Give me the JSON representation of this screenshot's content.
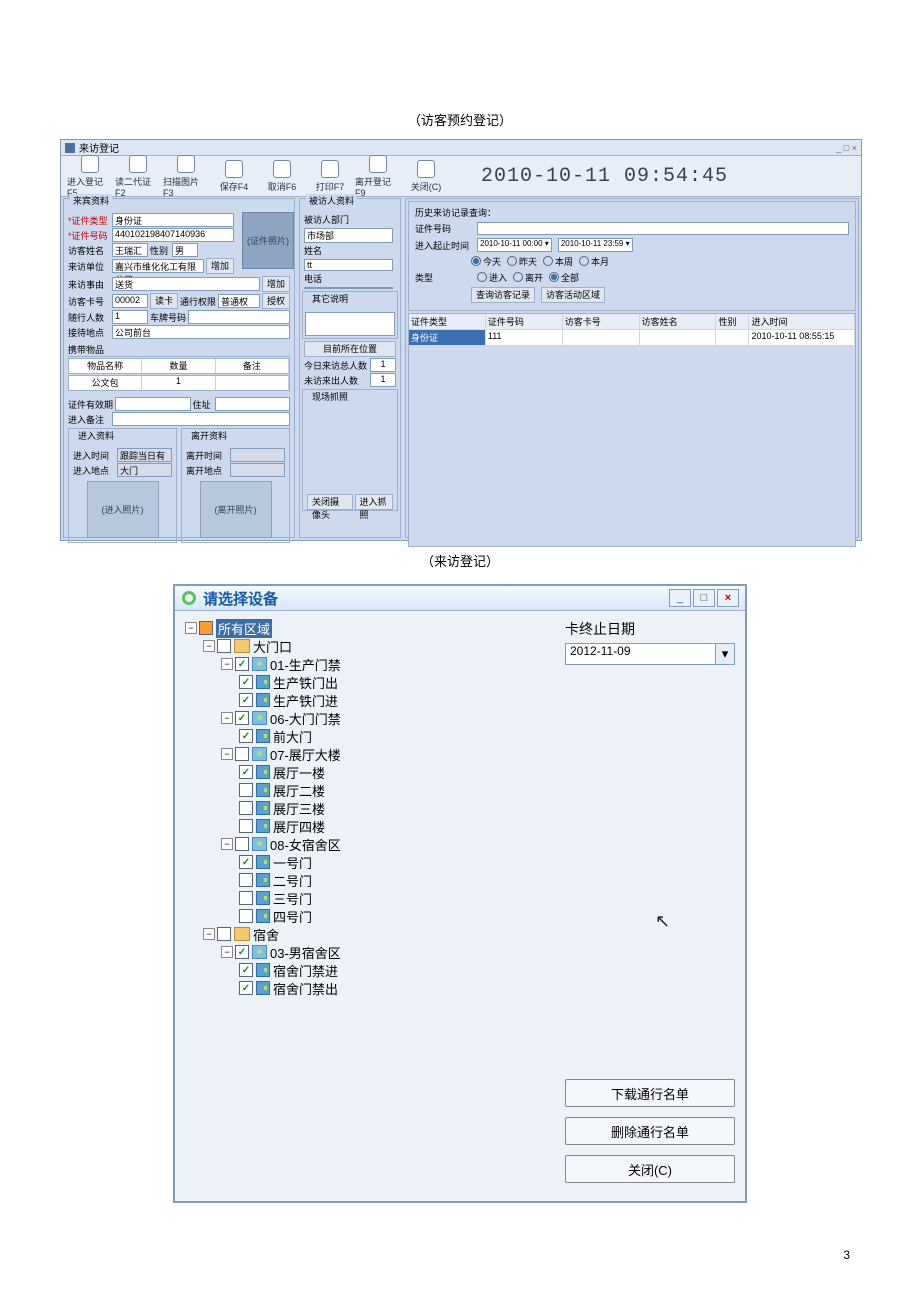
{
  "captions": {
    "appointment": "（访客预约登记）",
    "visit": "（来访登记）"
  },
  "page_number": "3",
  "app1": {
    "window_title": "来访登记",
    "window_controls": "_  □  ×",
    "toolbar": [
      {
        "label": "进入登记F5"
      },
      {
        "label": "读二代证F2"
      },
      {
        "label": "扫描图片F3"
      },
      {
        "label": "保存F4"
      },
      {
        "label": "取消F6"
      },
      {
        "label": "打印F7"
      },
      {
        "label": "离开登记F9"
      },
      {
        "label": "关闭(C)"
      }
    ],
    "clock": "2010-10-11 09:54:45",
    "guest_group": "来宾资料",
    "id_type_lbl": "*证件类型",
    "id_type_val": "身份证",
    "id_num_lbl": "*证件号码",
    "id_num_val": "440102198407140936",
    "name_lbl": "访客姓名",
    "name_val": "王瑞汇",
    "sex_lbl": "性别",
    "sex_val": "男",
    "unit_lbl": "来访单位",
    "unit_val": "嘉兴市维化化工有限公司",
    "unit_btn": "增加",
    "cert_photo": "(证件照片)",
    "reason_lbl": "来访事由",
    "reason_val": "送货",
    "reason_btn": "增加",
    "card_lbl": "访客卡号",
    "card_val": "00002",
    "card_btn": "读卡",
    "perm_lbl": "通行权限",
    "perm_val": "普通权限",
    "perm_btn": "授权",
    "follow_cnt_lbl": "随行人数",
    "follow_cnt_val": "1",
    "plate_lbl": "车牌号码",
    "recv_pt_lbl": "接待地点",
    "recv_pt_val": "公司前台",
    "items_group": "携带物品",
    "items_headers": [
      "物品名称",
      "数量",
      "备注"
    ],
    "item_sample": "公文包",
    "item_qty": "1",
    "valid_lbl": "证件有效期",
    "addr_lbl": "住址",
    "enter_note_lbl": "进入备注",
    "enter_group": "进入资料",
    "leave_group": "离开资料",
    "enter_time_lbl": "进入时间",
    "enter_time_val": "跟踪当日有效",
    "enter_pt_lbl": "进入地点",
    "enter_pt_val": "大门",
    "leave_time_lbl": "离开时间",
    "leave_pt_lbl": "离开地点",
    "enter_photo": "(进入照片)",
    "leave_photo": "(离开照片)",
    "host_group": "被访人资料",
    "host_dept_lbl": "被访人部门",
    "host_dept_val": "市场部",
    "host_name_lbl": "姓名",
    "host_name_val": "tt",
    "host_tel_lbl": "电话",
    "other_note_lbl": "其它说明",
    "cur_pos_lbl": "目前所在位置",
    "stat_today": "今日来访总人数",
    "stat_today_v": "1",
    "stat_pending": "未访来出人数",
    "stat_pending_v": "1",
    "cam_group": "现场抓照",
    "cam_close": "关闭摄像头",
    "cam_shot": "进入抓照",
    "search_title": "历史来访记录查询：",
    "s_id_lbl": "证件号码",
    "s_time_lbl": "进入起止时间",
    "s_time_from": "2010-10-11 00:00 ▾",
    "s_time_to": "2010-10-11 23:59 ▾",
    "s_today": "今天",
    "s_yesterday": "昨天",
    "s_week": "本周",
    "s_month": "本月",
    "s_type_lbl": "类型",
    "s_t_enter": "进入",
    "s_t_leave": "离开",
    "s_t_all": "全部",
    "s_btn_query": "查询访客记录",
    "s_btn_area": "访客活动区域",
    "hist_headers": [
      "证件类型",
      "证件号码",
      "访客卡号",
      "访客姓名",
      "性别",
      "进入时间"
    ],
    "hist_row": [
      "身份证",
      "111",
      "",
      "",
      "",
      "2010-10-11 08:55:15"
    ]
  },
  "app2": {
    "title": "请选择设备",
    "min": "_",
    "restore": "□",
    "close": "×",
    "side_label": "卡终止日期",
    "date_value": "2012-11-09",
    "btn_download": "下载通行名单",
    "btn_delete": "删除通行名单",
    "btn_close": "关闭(C)",
    "cursor": "↖",
    "tree": {
      "root": {
        "label": "所有区域",
        "checked": false
      },
      "gate": {
        "label": "大门口",
        "checked": false
      },
      "dev01": {
        "label": "01-生产门禁",
        "checked": true
      },
      "door_sc_out": {
        "label": "生产铁门出",
        "checked": true
      },
      "door_sc_in": {
        "label": "生产铁门进",
        "checked": true
      },
      "dev06": {
        "label": "06-大门门禁",
        "checked": true
      },
      "door_front": {
        "label": "前大门",
        "checked": true
      },
      "dev07": {
        "label": "07-展厅大楼",
        "checked": false
      },
      "hall1": {
        "label": "展厅一楼",
        "checked": true
      },
      "hall2": {
        "label": "展厅二楼",
        "checked": false
      },
      "hall3": {
        "label": "展厅三楼",
        "checked": false
      },
      "hall4": {
        "label": "展厅四楼",
        "checked": false
      },
      "dev08": {
        "label": "08-女宿舍区",
        "checked": false
      },
      "dorm1": {
        "label": "一号门",
        "checked": true
      },
      "dorm2": {
        "label": "二号门",
        "checked": false
      },
      "dorm3": {
        "label": "三号门",
        "checked": false
      },
      "dorm4": {
        "label": "四号门",
        "checked": false
      },
      "dorm_area": {
        "label": "宿舍",
        "checked": false
      },
      "dev03": {
        "label": "03-男宿舍区",
        "checked": true
      },
      "dorm_in": {
        "label": "宿舍门禁进",
        "checked": true
      },
      "dorm_out": {
        "label": "宿舍门禁出",
        "checked": true
      }
    }
  }
}
